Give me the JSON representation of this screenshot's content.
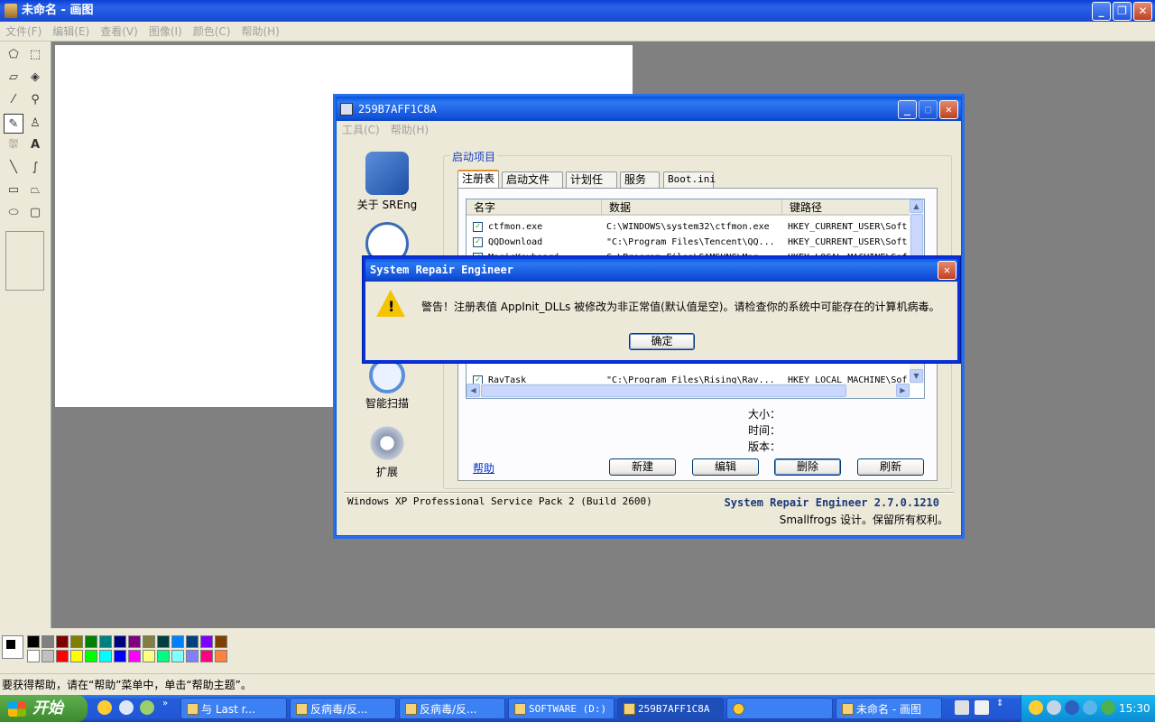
{
  "paint": {
    "title": "未命名 - 画图",
    "menu": [
      "文件(F)",
      "编辑(E)",
      "查看(V)",
      "图像(I)",
      "颜色(C)",
      "帮助(H)"
    ],
    "status": "要获得帮助，请在“帮助”菜单中，单击“帮助主题”。",
    "palette_colors": [
      "#000000",
      "#808080",
      "#800000",
      "#808000",
      "#008000",
      "#008080",
      "#000080",
      "#800080",
      "#808040",
      "#004040",
      "#0080ff",
      "#004080",
      "#8000ff",
      "#804000",
      "#ffffff",
      "#c0c0c0",
      "#ff0000",
      "#ffff00",
      "#00ff00",
      "#00ffff",
      "#0000ff",
      "#ff00ff",
      "#ffff80",
      "#00ff80",
      "#80ffff",
      "#8080ff",
      "#ff0080",
      "#ff8040"
    ]
  },
  "sreng": {
    "title": "259B7AFF1C8A",
    "menu": [
      "工具(C)",
      "帮助(H)"
    ],
    "side": {
      "about": "关于 SREng",
      "scan": "智能扫描",
      "extend": "扩展"
    },
    "group_title": "启动项目",
    "tabs": [
      "注册表",
      "启动文件夹",
      "计划任务",
      "服务",
      "Boot.ini"
    ],
    "list": {
      "headers": [
        "名字",
        "数据",
        "键路径"
      ],
      "rows": [
        {
          "name": "ctfmon.exe",
          "data": "C:\\WINDOWS\\system32\\ctfmon.exe",
          "path": "HKEY_CURRENT_USER\\Soft"
        },
        {
          "name": "QQDownload",
          "data": "\"C:\\Program Files\\Tencent\\QQ...",
          "path": "HKEY_CURRENT_USER\\Soft"
        },
        {
          "name": "MagicKeyboard",
          "data": "C:\\Program Files\\SAMSUNG\\Mag...",
          "path": "HKEY_LOCAL_MACHINE\\Sof"
        },
        {
          "name": "RavTask",
          "data": "\"C:\\Program Files\\Rising\\Rav...",
          "path": "HKEY_LOCAL_MACHINE\\Sof"
        }
      ]
    },
    "info_labels": [
      "大小：",
      "时间：",
      "版本："
    ],
    "help_link": "帮助",
    "buttons": [
      "新建",
      "编辑",
      "删除",
      "刷新"
    ],
    "os_info": "Windows XP Professional Service Pack 2 (Build 2600)",
    "version": "System Repair Engineer 2.7.0.1210",
    "copyright": "Smallfrogs 设计。保留所有权利。"
  },
  "alert": {
    "title": "System Repair Engineer",
    "message": "警告！注册表值 AppInit_DLLs 被修改为非正常值(默认值是空)。请检查你的系统中可能存在的计算机病毒。",
    "ok": "确定"
  },
  "taskbar": {
    "start": "开始",
    "tasks": [
      "与 Last r...",
      "反病毒/反...",
      "反病毒/反...",
      "SOFTWARE (D:)",
      "259B7AFF1C8A",
      "",
      "未命名 - 画图"
    ],
    "clock": "15:30"
  }
}
